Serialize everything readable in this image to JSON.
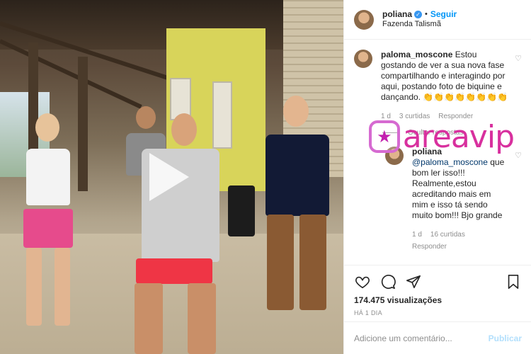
{
  "header": {
    "username": "poliana",
    "follow_label": "Seguir",
    "separator": "•",
    "location": "Fazenda Talismã"
  },
  "comments": [
    {
      "username": "paloma_moscone",
      "text": "Estou gostando de ver a sua nova fase compartilhando e interagindo por aqui, postando foto de biquine e dançando. 👏👏👏👏👏👏👏👏",
      "meta_time": "1 d",
      "meta_likes": "3 curtidas",
      "meta_reply": "Responder"
    }
  ],
  "replies_toggle": "Ocultar respostas",
  "reply": {
    "username": "poliana",
    "mention": "@paloma_moscone",
    "text": "que bom ler isso!!! Realmente,estou acreditando mais em mim e isso tá sendo muito bom!!! Bjo grande",
    "meta_time": "1 d",
    "meta_likes": "16 curtidas",
    "meta_reply": "Responder"
  },
  "post": {
    "views": "174.475 visualizações",
    "time": "HÁ 1 DIA"
  },
  "add_comment": {
    "placeholder": "Adicione um comentário...",
    "publish_label": "Publicar"
  },
  "watermark": {
    "text": "areavip",
    "icon": "star-icon"
  },
  "icons": [
    "heart-icon",
    "comment-icon",
    "share-icon",
    "bookmark-icon",
    "play-icon",
    "verified-icon"
  ],
  "colors": {
    "link_blue": "#0095f6",
    "verified_blue": "#3897f0",
    "watermark_pink": "#d8309e",
    "muted_gray": "#8e8e8e"
  }
}
